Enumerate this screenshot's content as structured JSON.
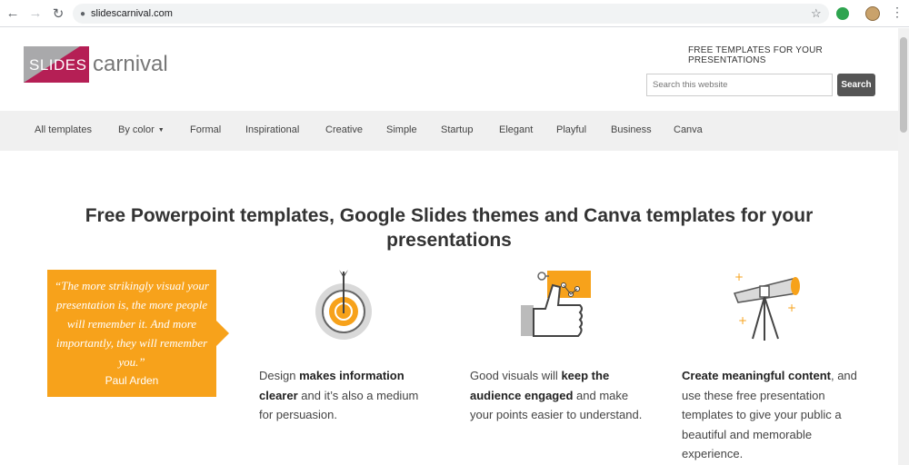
{
  "browser": {
    "url": "slidescarnival.com",
    "back_icon": "arrow-left-icon",
    "forward_icon": "arrow-right-icon",
    "reload_icon": "reload-icon",
    "bookmark_icon": "star-icon",
    "menu_icon": "more-vert-icon"
  },
  "header": {
    "logo_slides": "SLIDES",
    "logo_carnival": "carnival",
    "tagline": "FREE TEMPLATES FOR YOUR PRESENTATIONS",
    "search_placeholder": "Search this website",
    "search_button": "Search"
  },
  "nav": {
    "items": [
      "All templates",
      "By color",
      "Formal",
      "Inspirational",
      "Creative",
      "Simple",
      "Startup",
      "Elegant",
      "Playful",
      "Business",
      "Canva"
    ]
  },
  "main": {
    "headline": "Free Powerpoint templates, Google Slides themes and Canva templates for your presentations",
    "quote": {
      "text": "“The more strikingly visual your presentation is, the more people will remember it. And more importantly, they will remember you.”",
      "author": "Paul Arden"
    },
    "features": [
      {
        "icon": "target-icon",
        "pre": "Design ",
        "bold": "makes information clearer",
        "post": " and it’s also a medium for persuasion."
      },
      {
        "icon": "thumbs-up-icon",
        "pre": "Good visuals will ",
        "bold": "keep the audience engaged",
        "post": " and make your points easier to understand."
      },
      {
        "icon": "telescope-icon",
        "pre": "",
        "bold": "Create meaningful content",
        "post": ", and use these free presentation templates to give your public a beautiful and memorable experience."
      }
    ]
  },
  "colors": {
    "accent_orange": "#f7a21b",
    "logo_pink": "#b51f55",
    "logo_gray": "#a9a9ab",
    "nav_bg": "#f0f0f0",
    "button_dark": "#555555"
  }
}
